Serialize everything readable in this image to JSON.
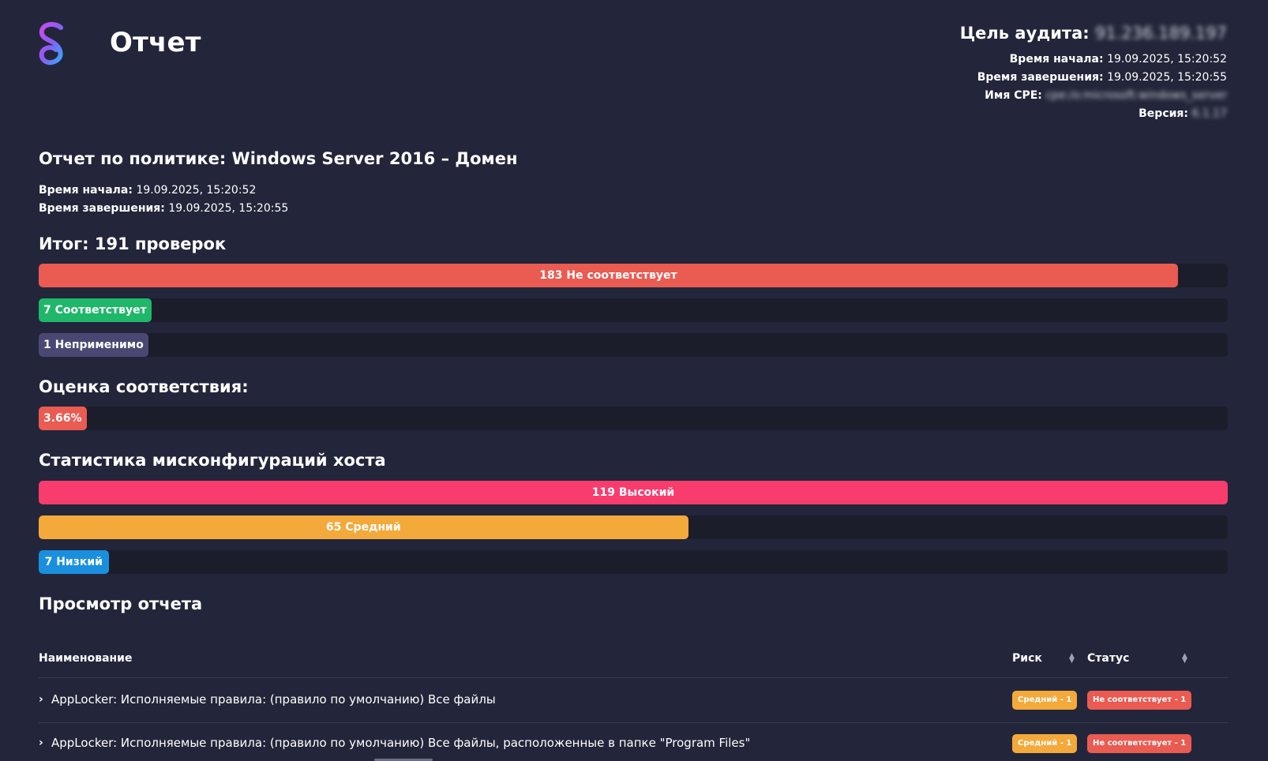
{
  "header": {
    "title": "Отчет",
    "audit_label": "Цель аудита:",
    "audit_target": "91.236.189.197",
    "start_label": "Время начала:",
    "start_value": "19.09.2025, 15:20:52",
    "end_label": "Время завершения:",
    "end_value": "19.09.2025, 15:20:55",
    "cpe_label": "Имя CPE:",
    "cpe_value": "cpe:/o:microsoft:windows_server",
    "version_label": "Версия:",
    "version_value": "6.1.17"
  },
  "policy": {
    "title": "Отчет по политике: Windows Server 2016 – Домен",
    "start_label": "Время начала:",
    "start_value": "19.09.2025, 15:20:52",
    "end_label": "Время завершения:",
    "end_value": "19.09.2025, 15:20:55"
  },
  "summary": {
    "title": "Итог: 191 проверок",
    "total": 191,
    "bars": [
      {
        "label": "183 Не соответствует",
        "value": 183,
        "color": "#ea5b52"
      },
      {
        "label": "7 Соответствует",
        "value": 7,
        "color": "#1fb76a"
      },
      {
        "label": "1 Неприменимо",
        "value": 1,
        "color": "#4a4873"
      }
    ]
  },
  "compliance": {
    "title": "Оценка соответствия:",
    "label": "3.66%",
    "value": 3.66,
    "color": "#ea5b52"
  },
  "misconfig": {
    "title": "Статистика мисконфигураций хоста",
    "total": 119,
    "bars": [
      {
        "label": "119 Высокий",
        "value": 119,
        "color": "#f83c6d"
      },
      {
        "label": "65 Средний",
        "value": 65,
        "color": "#f4a93b"
      },
      {
        "label": "7 Низкий",
        "value": 7,
        "color": "#1a8fde"
      }
    ]
  },
  "report_view": {
    "title": "Просмотр отчета",
    "columns": {
      "name": "Наименование",
      "risk": "Риск",
      "status": "Статус"
    },
    "rows": [
      {
        "name": "AppLocker: Исполняемые правила: (правило по умолчанию) Все файлы",
        "risk": "Средний - 1",
        "status": "Не соответствует - 1"
      },
      {
        "name": "AppLocker: Исполняемые правила: (правило по умолчанию) Все файлы, расположенные в папке \"Program Files\"",
        "risk": "Средний - 1",
        "status": "Не соответствует - 1"
      }
    ],
    "risk_color": "#f4a93b",
    "status_color": "#ea5b52"
  }
}
